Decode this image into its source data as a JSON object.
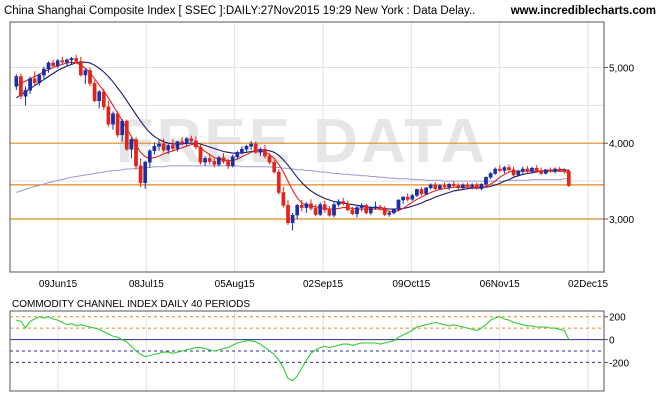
{
  "header": {
    "title": "China Shanghai Composite Index [ SSEC ]:DAILY:27Nov2015 19:29 New York : Data Delay..",
    "site": "www.incrediblecharts.com"
  },
  "watermark": "FREE DATA",
  "colors": {
    "up": "#1a2ea8",
    "down": "#e0251b",
    "ma_short": "#e0251b",
    "ma_mid": "#1a1a6e",
    "ma_long": "#9a9ad8",
    "cci": "#33cc33",
    "hline": "#e08a1e",
    "lower_band": "#2d2d9a",
    "grid": "#e2e2e2",
    "watermark": "#e6e6e6"
  },
  "chart_data": [
    {
      "type": "candlestick",
      "title": "China Shanghai Composite Index [ SSEC ]:DAILY:27Nov2015 19:29 New York : Data Delay..",
      "x_ticks": [
        "09Jun15",
        "08Jul15",
        "05Aug15",
        "02Sep15",
        "09Oct15",
        "06Nov15",
        "02Dec15"
      ],
      "y_ticks": [
        "3,000",
        "4,000",
        "5,000"
      ],
      "y_tick_values": [
        3000,
        4000,
        5000
      ],
      "ylim": [
        2300,
        5600
      ],
      "grid": true,
      "horizontal_lines": [
        3000,
        3450,
        4000
      ],
      "candles": [
        [
          4750,
          4910,
          4700,
          4880
        ],
        [
          4880,
          4920,
          4580,
          4620
        ],
        [
          4620,
          4750,
          4500,
          4700
        ],
        [
          4700,
          4880,
          4650,
          4850
        ],
        [
          4850,
          4950,
          4760,
          4800
        ],
        [
          4800,
          4920,
          4760,
          4900
        ],
        [
          4900,
          5010,
          4850,
          4980
        ],
        [
          4980,
          5080,
          4930,
          5060
        ],
        [
          5060,
          5100,
          4990,
          5020
        ],
        [
          5020,
          5110,
          4990,
          5090
        ],
        [
          5090,
          5140,
          5030,
          5070
        ],
        [
          5070,
          5120,
          5010,
          5100
        ],
        [
          5100,
          5140,
          5040,
          5120
        ],
        [
          5120,
          5170,
          5060,
          5080
        ],
        [
          5080,
          5140,
          4880,
          4900
        ],
        [
          4900,
          4990,
          4780,
          4960
        ],
        [
          4960,
          5000,
          4750,
          4790
        ],
        [
          4790,
          4830,
          4540,
          4560
        ],
        [
          4560,
          4700,
          4460,
          4680
        ],
        [
          4680,
          4720,
          4440,
          4480
        ],
        [
          4480,
          4560,
          4220,
          4250
        ],
        [
          4250,
          4420,
          4180,
          4390
        ],
        [
          4390,
          4420,
          4080,
          4110
        ],
        [
          4110,
          4320,
          4020,
          4290
        ],
        [
          4290,
          4310,
          3900,
          3920
        ],
        [
          3920,
          4070,
          3800,
          4050
        ],
        [
          4050,
          4080,
          3650,
          3700
        ],
        [
          3700,
          3800,
          3420,
          3480
        ],
        [
          3480,
          3770,
          3400,
          3750
        ],
        [
          3750,
          3920,
          3680,
          3900
        ],
        [
          3900,
          4010,
          3850,
          3960
        ],
        [
          3960,
          4040,
          3900,
          3990
        ],
        [
          3990,
          4060,
          3880,
          3910
        ],
        [
          3910,
          3990,
          3860,
          3970
        ],
        [
          3970,
          4050,
          3900,
          3930
        ],
        [
          3930,
          4030,
          3890,
          4020
        ],
        [
          4020,
          4080,
          3970,
          4000
        ],
        [
          4000,
          4080,
          3960,
          4060
        ],
        [
          4060,
          4100,
          3990,
          4030
        ],
        [
          4030,
          4090,
          3920,
          3950
        ],
        [
          3950,
          4000,
          3720,
          3750
        ],
        [
          3750,
          3830,
          3700,
          3800
        ],
        [
          3800,
          3860,
          3720,
          3760
        ],
        [
          3760,
          3800,
          3680,
          3720
        ],
        [
          3720,
          3830,
          3690,
          3810
        ],
        [
          3810,
          3870,
          3730,
          3760
        ],
        [
          3760,
          3790,
          3660,
          3700
        ],
        [
          3700,
          3850,
          3680,
          3820
        ],
        [
          3820,
          3900,
          3790,
          3880
        ],
        [
          3880,
          3960,
          3850,
          3920
        ],
        [
          3920,
          3980,
          3880,
          3960
        ],
        [
          3960,
          4030,
          3910,
          3990
        ],
        [
          3990,
          4020,
          3860,
          3880
        ],
        [
          3880,
          3940,
          3830,
          3920
        ],
        [
          3920,
          3980,
          3800,
          3830
        ],
        [
          3830,
          3870,
          3720,
          3750
        ],
        [
          3750,
          3780,
          3600,
          3620
        ],
        [
          3620,
          3660,
          3320,
          3350
        ],
        [
          3350,
          3420,
          3150,
          3180
        ],
        [
          3180,
          3250,
          2920,
          2950
        ],
        [
          2950,
          3080,
          2850,
          3050
        ],
        [
          3050,
          3200,
          3000,
          3180
        ],
        [
          3180,
          3250,
          3100,
          3150
        ],
        [
          3150,
          3220,
          3080,
          3200
        ],
        [
          3200,
          3260,
          3110,
          3140
        ],
        [
          3140,
          3190,
          3040,
          3060
        ],
        [
          3060,
          3220,
          3040,
          3190
        ],
        [
          3190,
          3240,
          3080,
          3120
        ],
        [
          3120,
          3170,
          3030,
          3050
        ],
        [
          3050,
          3220,
          3020,
          3190
        ],
        [
          3190,
          3260,
          3160,
          3230
        ],
        [
          3230,
          3280,
          3180,
          3200
        ],
        [
          3200,
          3240,
          3100,
          3120
        ],
        [
          3120,
          3160,
          3050,
          3070
        ],
        [
          3070,
          3180,
          3020,
          3150
        ],
        [
          3150,
          3210,
          3100,
          3180
        ],
        [
          3180,
          3200,
          3060,
          3080
        ],
        [
          3080,
          3170,
          3050,
          3150
        ],
        [
          3150,
          3230,
          3120,
          3160
        ],
        [
          3160,
          3190,
          3110,
          3140
        ],
        [
          3140,
          3170,
          3040,
          3060
        ],
        [
          3060,
          3100,
          3030,
          3080
        ],
        [
          3080,
          3140,
          3060,
          3130
        ],
        [
          3130,
          3260,
          3110,
          3250
        ],
        [
          3250,
          3300,
          3200,
          3290
        ],
        [
          3290,
          3340,
          3230,
          3260
        ],
        [
          3260,
          3330,
          3240,
          3310
        ],
        [
          3310,
          3400,
          3290,
          3390
        ],
        [
          3390,
          3420,
          3310,
          3330
        ],
        [
          3330,
          3420,
          3320,
          3410
        ],
        [
          3410,
          3470,
          3390,
          3450
        ],
        [
          3450,
          3480,
          3380,
          3400
        ],
        [
          3400,
          3460,
          3390,
          3440
        ],
        [
          3440,
          3480,
          3400,
          3420
        ],
        [
          3420,
          3470,
          3380,
          3460
        ],
        [
          3460,
          3500,
          3420,
          3440
        ],
        [
          3440,
          3470,
          3390,
          3410
        ],
        [
          3410,
          3470,
          3400,
          3450
        ],
        [
          3450,
          3480,
          3420,
          3430
        ],
        [
          3430,
          3470,
          3390,
          3450
        ],
        [
          3450,
          3480,
          3390,
          3400
        ],
        [
          3400,
          3470,
          3380,
          3460
        ],
        [
          3460,
          3560,
          3440,
          3550
        ],
        [
          3550,
          3620,
          3530,
          3600
        ],
        [
          3600,
          3680,
          3580,
          3660
        ],
        [
          3660,
          3710,
          3620,
          3640
        ],
        [
          3640,
          3700,
          3600,
          3680
        ],
        [
          3680,
          3720,
          3630,
          3650
        ],
        [
          3650,
          3690,
          3560,
          3580
        ],
        [
          3580,
          3650,
          3560,
          3630
        ],
        [
          3630,
          3690,
          3600,
          3660
        ],
        [
          3660,
          3700,
          3610,
          3630
        ],
        [
          3630,
          3690,
          3600,
          3670
        ],
        [
          3670,
          3710,
          3620,
          3640
        ],
        [
          3640,
          3680,
          3580,
          3600
        ],
        [
          3600,
          3660,
          3590,
          3650
        ],
        [
          3650,
          3680,
          3610,
          3630
        ],
        [
          3630,
          3680,
          3600,
          3660
        ],
        [
          3660,
          3690,
          3620,
          3640
        ],
        [
          3640,
          3670,
          3600,
          3630
        ],
        [
          3630,
          3660,
          3420,
          3440
        ]
      ],
      "ma_short": [
        4760,
        4790,
        4820,
        4850,
        4880,
        4910,
        4940,
        4970,
        5000,
        5020,
        5040,
        5060,
        5070,
        5060,
        5030,
        4990,
        4930,
        4850,
        4770,
        4690,
        4600,
        4500,
        4400,
        4300,
        4190,
        4090,
        3980,
        3880,
        3820,
        3800,
        3810,
        3830,
        3860,
        3880,
        3900,
        3920,
        3940,
        3960,
        3980,
        3980,
        3940,
        3890,
        3850,
        3810,
        3790,
        3780,
        3770,
        3770,
        3790,
        3820,
        3850,
        3880,
        3900,
        3900,
        3880,
        3850,
        3800,
        3720,
        3620,
        3500,
        3380,
        3280,
        3210,
        3180,
        3170,
        3160,
        3150,
        3140,
        3130,
        3130,
        3140,
        3150,
        3150,
        3140,
        3130,
        3130,
        3130,
        3130,
        3130,
        3130,
        3120,
        3100,
        3100,
        3110,
        3140,
        3180,
        3220,
        3260,
        3290,
        3320,
        3350,
        3370,
        3390,
        3400,
        3410,
        3420,
        3420,
        3420,
        3420,
        3420,
        3420,
        3420,
        3430,
        3460,
        3500,
        3550,
        3590,
        3620,
        3630,
        3630,
        3630,
        3630,
        3630,
        3630,
        3630,
        3630,
        3630,
        3630,
        3630,
        3630,
        3600
      ],
      "ma_mid": [
        4600,
        4640,
        4680,
        4720,
        4760,
        4800,
        4840,
        4880,
        4920,
        4960,
        4990,
        5020,
        5040,
        5060,
        5070,
        5070,
        5060,
        5030,
        4990,
        4940,
        4880,
        4810,
        4730,
        4650,
        4560,
        4470,
        4380,
        4290,
        4210,
        4140,
        4090,
        4050,
        4020,
        4000,
        3990,
        3990,
        3990,
        4000,
        4000,
        4000,
        3990,
        3970,
        3950,
        3930,
        3910,
        3890,
        3880,
        3870,
        3870,
        3870,
        3880,
        3890,
        3900,
        3910,
        3910,
        3900,
        3880,
        3840,
        3780,
        3710,
        3630,
        3550,
        3480,
        3420,
        3370,
        3330,
        3300,
        3270,
        3250,
        3230,
        3220,
        3210,
        3200,
        3190,
        3180,
        3170,
        3160,
        3150,
        3150,
        3150,
        3140,
        3130,
        3130,
        3130,
        3140,
        3150,
        3170,
        3190,
        3210,
        3240,
        3260,
        3290,
        3310,
        3330,
        3350,
        3370,
        3380,
        3390,
        3400,
        3410,
        3410,
        3420,
        3420,
        3430,
        3450,
        3470,
        3500,
        3520,
        3550,
        3570,
        3590,
        3600,
        3610,
        3620,
        3630,
        3640,
        3640,
        3640,
        3650,
        3650,
        3640
      ],
      "ma_long": [
        3350,
        3370,
        3390,
        3410,
        3430,
        3440,
        3460,
        3480,
        3490,
        3510,
        3520,
        3540,
        3550,
        3560,
        3570,
        3580,
        3590,
        3600,
        3610,
        3620,
        3630,
        3640,
        3640,
        3650,
        3660,
        3660,
        3670,
        3670,
        3680,
        3680,
        3690,
        3690,
        3690,
        3700,
        3700,
        3700,
        3700,
        3700,
        3700,
        3700,
        3700,
        3700,
        3700,
        3700,
        3700,
        3700,
        3700,
        3700,
        3700,
        3690,
        3690,
        3690,
        3690,
        3690,
        3690,
        3690,
        3680,
        3680,
        3670,
        3670,
        3660,
        3650,
        3650,
        3640,
        3640,
        3630,
        3620,
        3620,
        3610,
        3600,
        3600,
        3590,
        3590,
        3580,
        3580,
        3570,
        3570,
        3560,
        3560,
        3550,
        3550,
        3540,
        3540,
        3530,
        3530,
        3530,
        3520,
        3520,
        3520,
        3510,
        3510,
        3510,
        3510,
        3500,
        3500,
        3500,
        3500,
        3500,
        3500,
        3500,
        3500,
        3500,
        3500,
        3500,
        3500,
        3500,
        3500,
        3510,
        3510,
        3510,
        3510,
        3510,
        3520,
        3520,
        3520,
        3520,
        3520,
        3520,
        3520,
        3530,
        3530
      ]
    },
    {
      "type": "line",
      "title": "COMMODITY CHANNEL INDEX DAILY 40 PERIODS",
      "y_ticks": [
        "200",
        "0",
        "-200"
      ],
      "y_tick_values": [
        200,
        0,
        -200
      ],
      "ylim": [
        -450,
        250
      ],
      "dashed_levels": [
        -200,
        -100,
        100,
        200
      ],
      "reference_line": 0,
      "series": [
        {
          "values": [
            170,
            160,
            100,
            160,
            180,
            200,
            190,
            200,
            180,
            170,
            150,
            130,
            140,
            120,
            130,
            120,
            110,
            100,
            90,
            70,
            50,
            30,
            20,
            0,
            -20,
            -60,
            -100,
            -130,
            -150,
            -140,
            -130,
            -120,
            -110,
            -110,
            -120,
            -110,
            -100,
            -90,
            -80,
            -70,
            -70,
            -80,
            -90,
            -100,
            -90,
            -80,
            -70,
            -50,
            -30,
            -20,
            -10,
            -10,
            -20,
            -40,
            -70,
            -100,
            -130,
            -180,
            -250,
            -340,
            -360,
            -320,
            -250,
            -180,
            -120,
            -90,
            -70,
            -60,
            -70,
            -60,
            -50,
            -40,
            -40,
            -50,
            -40,
            -30,
            -30,
            -30,
            -30,
            -40,
            -30,
            -20,
            -10,
            20,
            40,
            60,
            80,
            110,
            120,
            130,
            140,
            150,
            140,
            130,
            120,
            130,
            120,
            110,
            100,
            90,
            80,
            100,
            130,
            170,
            190,
            200,
            180,
            170,
            150,
            140,
            130,
            120,
            120,
            110,
            110,
            110,
            100,
            100,
            90,
            80,
            0
          ]
        }
      ]
    }
  ]
}
